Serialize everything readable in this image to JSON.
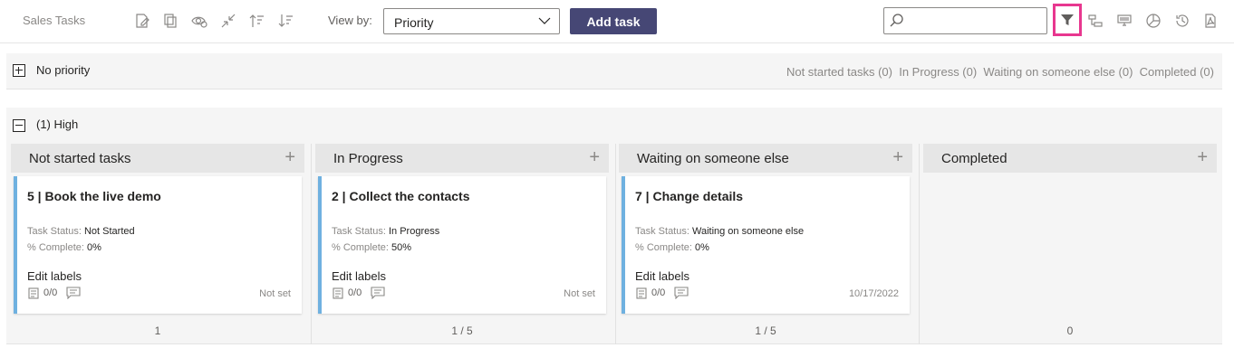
{
  "app": {
    "title": "Sales Tasks"
  },
  "toolbar": {
    "icons": [
      "edit-icon",
      "copy-icon",
      "visibility-icon",
      "collapse-icon",
      "sort-ascending-icon",
      "sort-descending-icon"
    ],
    "viewby_label": "View by:",
    "viewby_value": "Priority",
    "add_task_label": "Add task",
    "search_placeholder": "",
    "right_icons": [
      "filter-icon",
      "hierarchy-icon",
      "board-icon",
      "chart-icon",
      "history-icon",
      "pdf-icon"
    ]
  },
  "colors": {
    "accent": "#464775",
    "highlight": "#e8378f",
    "card_bar": "#6fb1e0"
  },
  "groups": {
    "no_priority": {
      "title": "No priority",
      "summary": "Not started tasks (0)  In Progress (0)  Waiting on someone else (0)  Completed (0)"
    },
    "high": {
      "title": "(1) High",
      "columns": [
        {
          "title": "Not started tasks",
          "count": "1",
          "card": {
            "title": "5 | Book the live demo",
            "status_label": "Task Status:",
            "status_value": "Not Started",
            "complete_label": "% Complete:",
            "complete_value": "0%",
            "edit_labels": "Edit labels",
            "checklist": "0/0",
            "date": "Not set"
          }
        },
        {
          "title": "In Progress",
          "count": "1 / 5",
          "card": {
            "title": "2 | Collect the contacts",
            "status_label": "Task Status:",
            "status_value": "In Progress",
            "complete_label": "% Complete:",
            "complete_value": "50%",
            "edit_labels": "Edit labels",
            "checklist": "0/0",
            "date": "Not set"
          }
        },
        {
          "title": "Waiting on someone else",
          "count": "1 / 5",
          "card": {
            "title": "7 | Change details",
            "status_label": "Task Status:",
            "status_value": "Waiting on someone else",
            "complete_label": "% Complete:",
            "complete_value": "0%",
            "edit_labels": "Edit labels",
            "checklist": "0/0",
            "date": "10/17/2022"
          }
        },
        {
          "title": "Completed",
          "count": "0"
        }
      ]
    }
  }
}
